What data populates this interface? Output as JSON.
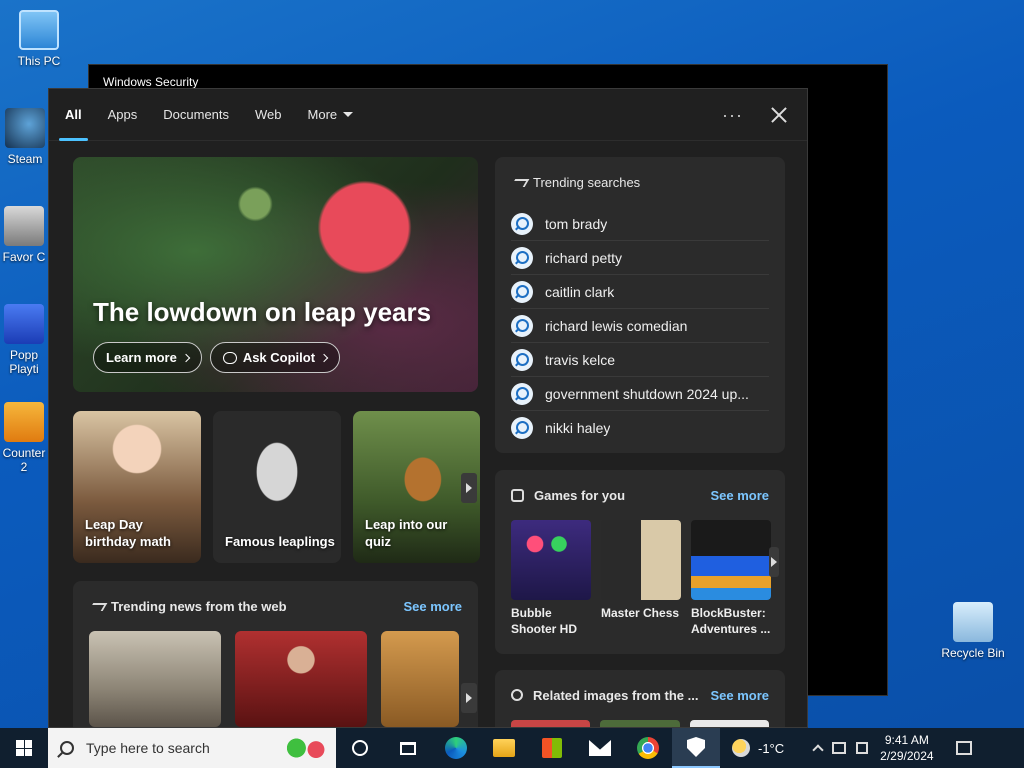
{
  "desktop": {
    "icons": [
      {
        "label": "This PC"
      },
      {
        "label": "Steam"
      },
      {
        "label": "Favor C"
      },
      {
        "label": "Popp Playti"
      },
      {
        "label": "Counter 2"
      },
      {
        "label": "Recycle Bin"
      }
    ]
  },
  "background_window": {
    "title": "Windows Security"
  },
  "search_panel": {
    "tabs": [
      {
        "label": "All"
      },
      {
        "label": "Apps"
      },
      {
        "label": "Documents"
      },
      {
        "label": "Web"
      },
      {
        "label": "More"
      }
    ],
    "more_options_label": "···",
    "hero": {
      "title": "The lowdown on leap years",
      "learn_more": "Learn more",
      "ask_copilot": "Ask Copilot"
    },
    "cards": [
      {
        "label": "Leap Day birthday math"
      },
      {
        "label": "Famous leaplings"
      },
      {
        "label": "Leap into our quiz"
      }
    ],
    "news": {
      "title": "Trending news from the web",
      "see_more": "See more"
    },
    "trending": {
      "title": "Trending searches",
      "items": [
        "tom brady",
        "richard petty",
        "caitlin clark",
        "richard lewis comedian",
        "travis kelce",
        "government shutdown 2024 up...",
        "nikki haley"
      ]
    },
    "games": {
      "title": "Games for you",
      "see_more": "See more",
      "items": [
        {
          "name": "Bubble Shooter HD"
        },
        {
          "name": "Master Chess"
        },
        {
          "name": "BlockBuster: Adventures ..."
        }
      ]
    },
    "related": {
      "title": "Related images from the ...",
      "see_more": "See more"
    }
  },
  "taskbar": {
    "search_placeholder": "Type here to search",
    "weather": "-1°C",
    "time": "9:41 AM",
    "date": "2/29/2024"
  }
}
